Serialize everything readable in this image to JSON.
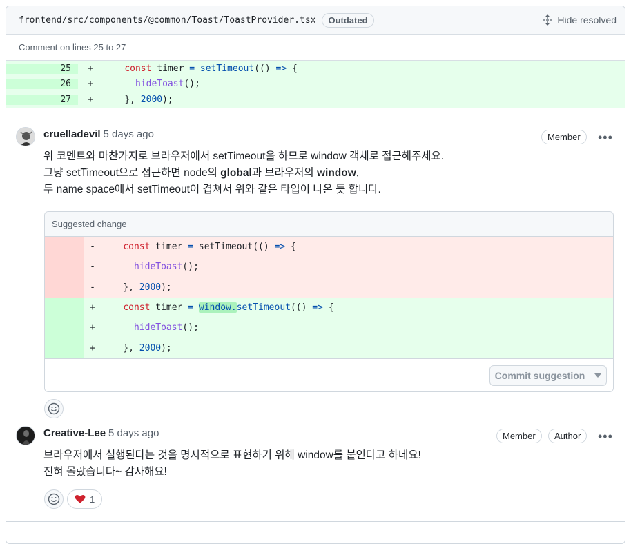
{
  "file_header": {
    "path": "frontend/src/components/@common/Toast/ToastProvider.tsx",
    "outdated_label": "Outdated",
    "hide_resolved_label": "Hide resolved"
  },
  "comment_lines_label": "Comment on lines 25 to 27",
  "context_lines": [
    {
      "num": "25",
      "sign": "+"
    },
    {
      "num": "26",
      "sign": "+"
    },
    {
      "num": "27",
      "sign": "+"
    }
  ],
  "code_tokens": {
    "const": "const",
    "timer": " timer ",
    "eq": "=",
    "setTimeout": "setTimeout",
    "open_call": "(() ",
    "arrow": "=>",
    "brace_open": " {",
    "hideToast": "hideToast",
    "call_end": "();",
    "close": "}, ",
    "num2000": "2000",
    "close_end": ");",
    "window": "window.",
    "minus": "-",
    "plus": "+"
  },
  "comments": [
    {
      "author": "cruelladevil",
      "time": "5 days ago",
      "badges": [
        "Member"
      ],
      "lines": {
        "l1": "위 코멘트와 마찬가지로 브라우저에서 setTimeout을 하므로 window 객체로 접근해주세요.",
        "l2_a": "그냥 setTimeout으로 접근하면 node의 ",
        "l2_b": "global",
        "l2_c": "과 브라우저의 ",
        "l2_d": "window",
        "l2_e": ",",
        "l3": "두 name space에서 setTimeout이 겹쳐서 위와 같은 타입이 나온 듯 합니다."
      }
    },
    {
      "author": "Creative-Lee",
      "time": "5 days ago",
      "badges": [
        "Member",
        "Author"
      ],
      "lines": {
        "l1": "브라우저에서 실행된다는 것을 명시적으로 표현하기 위해 window를 붙인다고 하네요!",
        "l2": "전혀 몰랐습니다~ 감사해요!"
      },
      "reactions": [
        {
          "emoji": "heart",
          "count": "1"
        }
      ]
    }
  ],
  "suggestion": {
    "header": "Suggested change",
    "commit_label": "Commit suggestion"
  },
  "icons": {
    "unfold": "unfold-icon",
    "kebab": "kebab-horizontal-icon",
    "smiley": "smiley-icon",
    "heart": "heart-icon",
    "caret": "triangle-down-icon"
  },
  "colors": {
    "add_bg": "#e6ffec",
    "del_bg": "#ffebe9",
    "border": "#d0d7de",
    "muted": "#57606a",
    "heart": "#cf222e"
  }
}
